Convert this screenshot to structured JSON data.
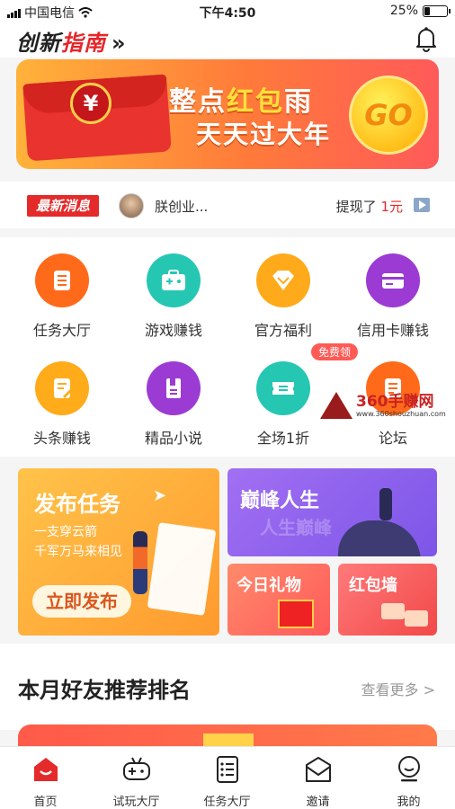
{
  "status_bar": {
    "carrier": "中国电信",
    "time": "下午4:50",
    "battery_percent": "25%",
    "battery_level": 0.25
  },
  "header": {
    "logo_text_black": "创新",
    "logo_text_red": "指南",
    "logo_chevrons": "»",
    "bell_icon": "bell-icon"
  },
  "banner": {
    "title_part1": "整点",
    "title_highlight": "红包",
    "title_part2": "雨",
    "subtitle": "天天过大年",
    "go_label": "GO",
    "envelope_symbol": "¥"
  },
  "news": {
    "tag": "最新消息",
    "user": "朕创业...",
    "action": "提现了",
    "amount": "1元"
  },
  "grid": {
    "items": [
      {
        "label": "任务大厅",
        "icon": "task-list-icon",
        "color": "#ff6a1a"
      },
      {
        "label": "游戏赚钱",
        "icon": "game-box-icon",
        "color": "#25c7b3"
      },
      {
        "label": "官方福利",
        "icon": "diamond-icon",
        "color": "#ffaa1a"
      },
      {
        "label": "信用卡赚钱",
        "icon": "credit-card-icon",
        "color": "#9b3bd4"
      },
      {
        "label": "头条赚钱",
        "icon": "edit-doc-icon",
        "color": "#ffab1a"
      },
      {
        "label": "精品小说",
        "icon": "book-icon",
        "color": "#9b3bd4"
      },
      {
        "label": "全场1折",
        "icon": "ticket-icon",
        "color": "#25c7b3"
      },
      {
        "label": "论坛",
        "icon": "forum-doc-icon",
        "color": "#ff6a1a"
      }
    ],
    "badge": "免费领",
    "watermark_title": "360手赚网",
    "watermark_url": "www.360shouzhuan.com"
  },
  "cards": {
    "publish": {
      "title": "发布任务",
      "line1": "一支穿云箭",
      "line2": "千军万马来相见",
      "button": "立即发布"
    },
    "peak": {
      "title": "巅峰人生",
      "ghost": "人生巅峰"
    },
    "gift": {
      "title": "今日礼物"
    },
    "wall": {
      "title": "红包墙"
    }
  },
  "ranking": {
    "title": "本月好友推荐排名",
    "more": "查看更多 >"
  },
  "tabbar": {
    "tabs": [
      {
        "label": "首页",
        "icon": "home-icon"
      },
      {
        "label": "试玩大厅",
        "icon": "gamepad-icon"
      },
      {
        "label": "任务大厅",
        "icon": "task-list-icon"
      },
      {
        "label": "邀请",
        "icon": "invite-mail-icon"
      },
      {
        "label": "我的",
        "icon": "profile-icon"
      }
    ]
  },
  "colors": {
    "accent_red": "#e42a2a",
    "brand_orange": "#ff7a3a"
  }
}
